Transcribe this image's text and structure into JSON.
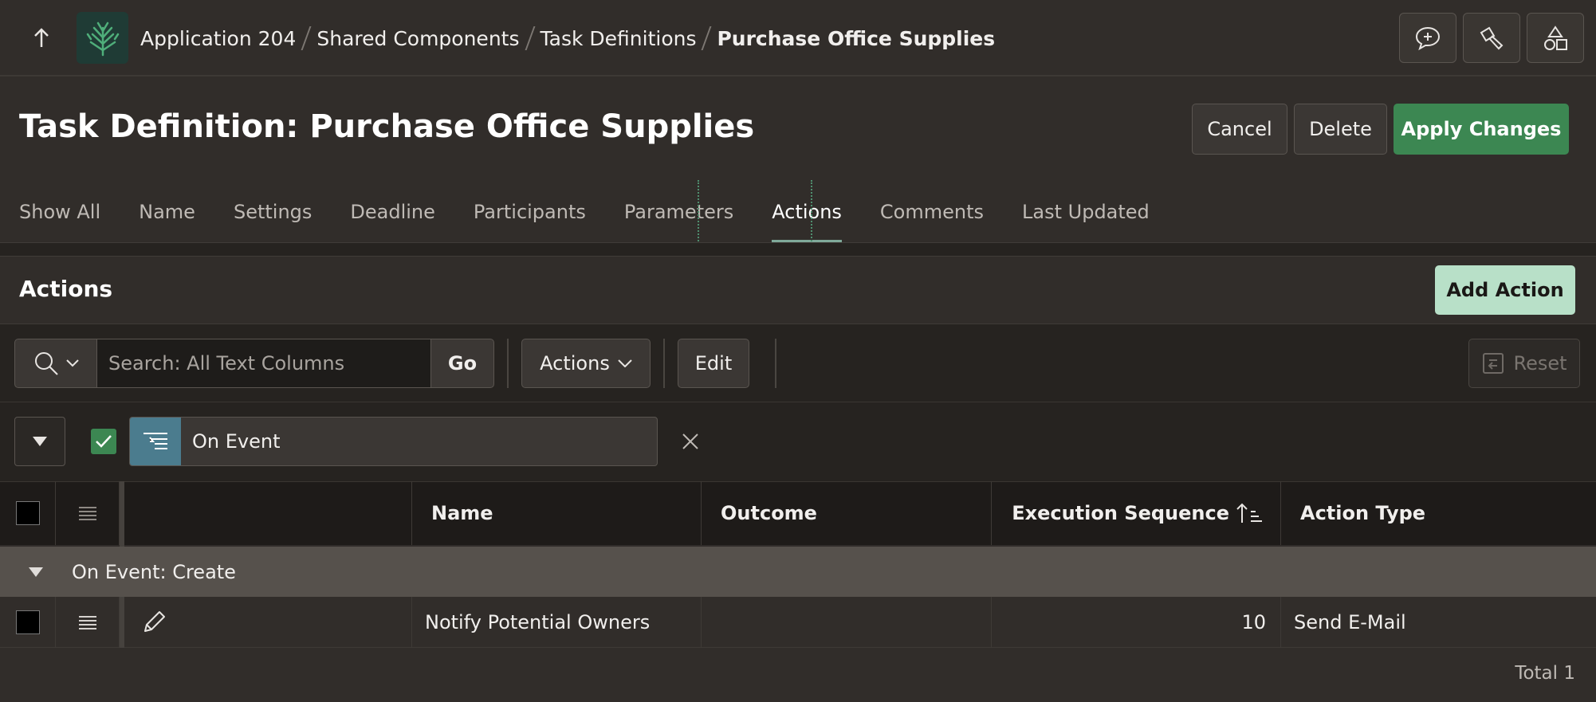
{
  "breadcrumb": {
    "items": [
      "Application 204",
      "Shared Components",
      "Task Definitions",
      "Purchase Office Supplies"
    ]
  },
  "page": {
    "title": "Task Definition: Purchase Office Supplies"
  },
  "header_buttons": {
    "cancel": "Cancel",
    "delete": "Delete",
    "apply": "Apply Changes"
  },
  "tabs": [
    {
      "label": "Show All",
      "active": false
    },
    {
      "label": "Name",
      "active": false
    },
    {
      "label": "Settings",
      "active": false
    },
    {
      "label": "Deadline",
      "active": false
    },
    {
      "label": "Participants",
      "active": false
    },
    {
      "label": "Parameters",
      "active": false
    },
    {
      "label": "Actions",
      "active": true
    },
    {
      "label": "Comments",
      "active": false
    },
    {
      "label": "Last Updated",
      "active": false
    }
  ],
  "region": {
    "title": "Actions",
    "add_button": "Add Action"
  },
  "toolbar": {
    "search_placeholder": "Search: All Text Columns",
    "go": "Go",
    "actions": "Actions",
    "edit": "Edit",
    "reset": "Reset"
  },
  "filter": {
    "label": "On Event",
    "enabled": true
  },
  "grid": {
    "columns": [
      "Name",
      "Outcome",
      "Execution Sequence",
      "Action Type"
    ],
    "group_label": "On Event: Create",
    "rows": [
      {
        "name": "Notify Potential Owners",
        "outcome": "",
        "sequence": "10",
        "action_type": "Send E-Mail"
      }
    ],
    "total": "Total 1"
  },
  "colors": {
    "background": "#312d2a",
    "primary": "#3c8752",
    "add_button": "#b8e0c8",
    "filter_icon": "#4b7c8e",
    "tab_indicator": "#7fa99a"
  }
}
